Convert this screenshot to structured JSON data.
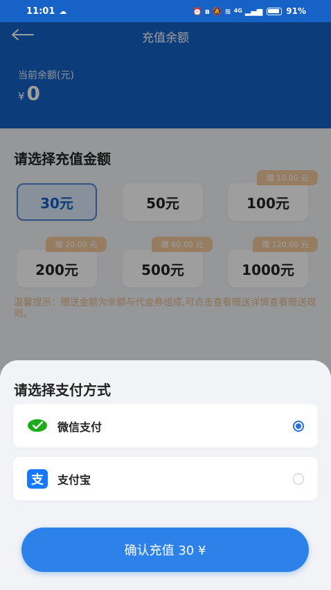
{
  "status_bar": {
    "time": "11:01",
    "network": "4G",
    "battery": "91%"
  },
  "header": {
    "title": "充值余额",
    "balance_label": "当前余额(元)",
    "currency": "¥",
    "balance": "0"
  },
  "recharge": {
    "section_title": "请选择充值金额",
    "options": [
      {
        "label": "30元",
        "bonus": "",
        "selected": true
      },
      {
        "label": "50元",
        "bonus": "",
        "selected": false
      },
      {
        "label": "100元",
        "bonus": "赠 10.00 元",
        "selected": false
      },
      {
        "label": "200元",
        "bonus": "赠 20.00 元",
        "selected": false
      },
      {
        "label": "500元",
        "bonus": "赠 60.00 元",
        "selected": false
      },
      {
        "label": "1000元",
        "bonus": "赠 120.00 元",
        "selected": false
      }
    ],
    "tip": "温馨提示：赠送金额为余额与代金券组成,可点击查看赠送详情查看赠送规则。"
  },
  "payment_sheet": {
    "title": "请选择支付方式",
    "methods": [
      {
        "label": "微信支付",
        "icon": "wechat-pay-icon",
        "selected": true
      },
      {
        "label": "支付宝",
        "icon": "alipay-icon",
        "selected": false
      }
    ],
    "confirm_label": "确认充值 30 ¥"
  },
  "colors": {
    "primary": "#1662c7",
    "button": "#2c82e8",
    "bonus_tag": "#f2c99c",
    "selected_card_bg": "#dbe8fb",
    "wechat_green": "#1aad19",
    "alipay_blue": "#1677ff"
  }
}
